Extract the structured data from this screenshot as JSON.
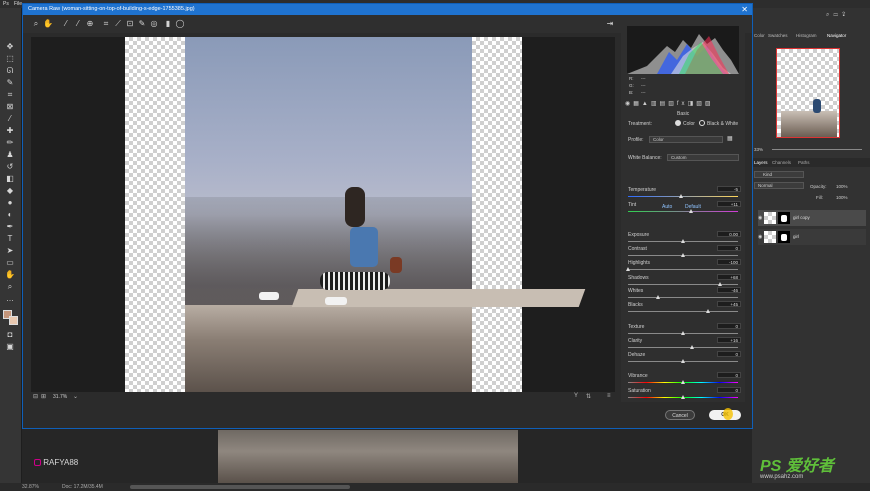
{
  "ps": {
    "app_label": "File",
    "zoom_status": "32.87%",
    "doc_status": "Doc: 17.2M/35.4M",
    "watermark": "RAFYA88",
    "logo_text": "PS 爱好者",
    "logo_url": "www.psahz.com"
  },
  "ps_right": {
    "tabs": [
      "Color",
      "Swatches",
      "Histogram",
      "Navigator"
    ],
    "layers_tabs": [
      "Layers",
      "Channels",
      "Paths"
    ],
    "kind": "Kind",
    "blend_mode": "Normal",
    "opacity_label": "Opacity:",
    "opacity_value": "100%",
    "fill_label": "Fill:",
    "fill_value": "100%",
    "layers": [
      {
        "name": "girl copy"
      },
      {
        "name": "girl"
      }
    ],
    "nav_zoom": "33%"
  },
  "camera_raw": {
    "title": "Camera Raw (woman-sitting-on-top-of-building-s-edge-1755385.jpg)",
    "zoom": "31.7%",
    "rgb": {
      "r": "R:",
      "g": "G:",
      "b": "B:",
      "dash": "---"
    },
    "panel_name": "Basic",
    "treatment_label": "Treatment:",
    "treatment_color": "Color",
    "treatment_bw": "Black & White",
    "profile_label": "Profile:",
    "profile_value": "Color",
    "wb_label": "White Balance:",
    "wb_value": "Custom",
    "auto": "Auto",
    "default": "Default",
    "sliders": [
      {
        "label": "Temperature",
        "value": "-5",
        "pos": 0.48
      },
      {
        "label": "Tint",
        "value": "+11",
        "pos": 0.57
      },
      {
        "label": "Exposure",
        "value": "0.00",
        "pos": 0.5
      },
      {
        "label": "Contrast",
        "value": "0",
        "pos": 0.5
      },
      {
        "label": "Highlights",
        "value": "-100",
        "pos": 0.0
      },
      {
        "label": "Shadows",
        "value": "+68",
        "pos": 0.84
      },
      {
        "label": "Whites",
        "value": "-46",
        "pos": 0.27
      },
      {
        "label": "Blacks",
        "value": "+45",
        "pos": 0.73
      },
      {
        "label": "Texture",
        "value": "0",
        "pos": 0.5
      },
      {
        "label": "Clarity",
        "value": "+16",
        "pos": 0.58
      },
      {
        "label": "Dehaze",
        "value": "0",
        "pos": 0.5
      },
      {
        "label": "Vibrance",
        "value": "0",
        "pos": 0.5
      },
      {
        "label": "Saturation",
        "value": "0",
        "pos": 0.5
      }
    ],
    "cancel": "Cancel",
    "ok": "OK"
  }
}
